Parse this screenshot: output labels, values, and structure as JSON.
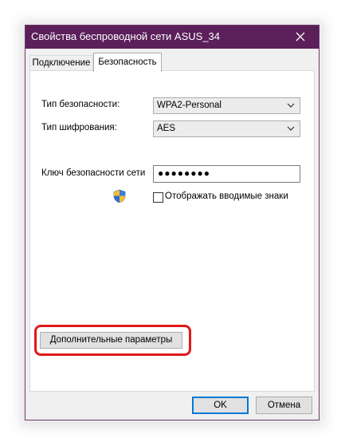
{
  "window": {
    "title": "Свойства беспроводной сети ASUS_34"
  },
  "tabs": [
    {
      "label": "Подключение",
      "active": false
    },
    {
      "label": "Безопасность",
      "active": true
    }
  ],
  "security": {
    "security_type_label": "Тип безопасности:",
    "security_type_value": "WPA2-Personal",
    "encryption_type_label": "Тип шифрования:",
    "encryption_type_value": "AES",
    "key_label": "Ключ безопасности сети",
    "key_value": "●●●●●●●●",
    "show_chars_label": "Отображать вводимые знаки",
    "show_chars_checked": false
  },
  "advanced_button_label": "Дополнительные параметры",
  "footer": {
    "ok_label": "OK",
    "cancel_label": "Отмена"
  },
  "colors": {
    "titlebar": "#5b1f5a",
    "highlight": "#e0191b",
    "default_button_border": "#0078d7"
  },
  "icons": [
    "close-icon",
    "chevron-down-icon",
    "uac-shield-icon"
  ]
}
